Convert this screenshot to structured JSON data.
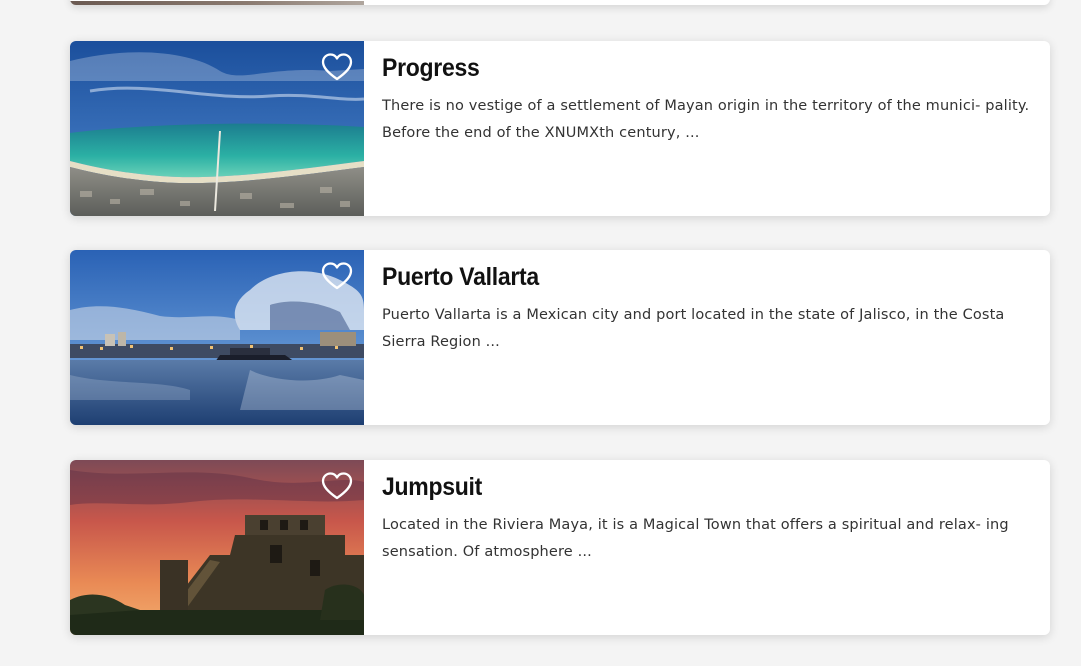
{
  "cards": [
    {
      "title": "Progress",
      "description": "There is no vestige of a settlement of Mayan origin in the territory of the munici- pality. Before the end of the XNUMXth century, ...",
      "image": "aerial-beach-coastline",
      "favorite_icon": "heart-outline-icon"
    },
    {
      "title": "Puerto Vallarta",
      "description": "Puerto Vallarta is a Mexican city and port located in the state of Jalisco, in the Costa Sierra Region ...",
      "image": "harbor-reflection-dusk",
      "favorite_icon": "heart-outline-icon"
    },
    {
      "title": "Jumpsuit",
      "description": "Located in the Riviera Maya, it is a Magical Town that offers a spiritual and relax- ing sensation. Of atmosphere ...",
      "image": "mayan-ruins-sunset",
      "favorite_icon": "heart-outline-icon"
    }
  ],
  "colors": {
    "background": "#f4f4f4",
    "card": "#ffffff",
    "title": "#111111",
    "text": "#333333",
    "heart": "#ffffff"
  }
}
